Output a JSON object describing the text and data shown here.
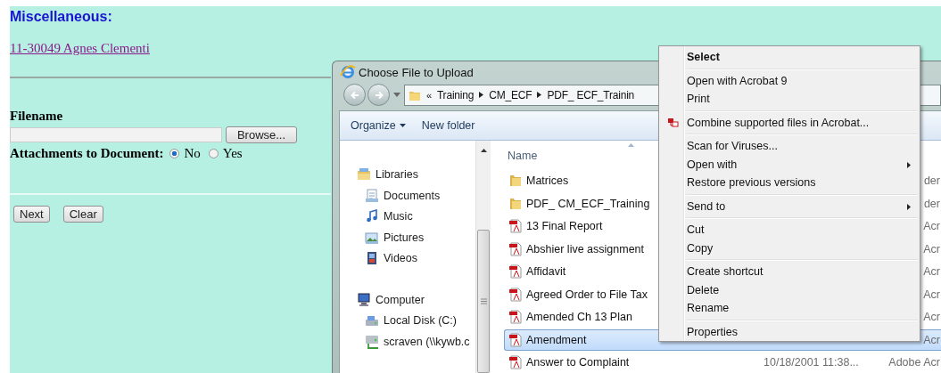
{
  "page": {
    "heading": "Miscellaneous:",
    "case_link": "11-30049 Agnes Clementi",
    "filename_label": "Filename",
    "browse_button": "Browse...",
    "attachments_label": "Attachments to Document:",
    "attachment_options": [
      {
        "label": "No",
        "selected": true
      },
      {
        "label": "Yes",
        "selected": false
      }
    ],
    "buttons": [
      "Next",
      "Clear"
    ]
  },
  "dialog": {
    "title": "Choose File to Upload",
    "address": {
      "overflow": "«",
      "segments": [
        "Training",
        "CM_ECF",
        "PDF_ ECF_Trainin"
      ]
    },
    "toolbar": [
      {
        "label": "Organize",
        "dropdown": true
      },
      {
        "label": "New folder",
        "dropdown": false
      }
    ],
    "nav": [
      {
        "label": "Libraries",
        "kind": "library",
        "children": [
          {
            "label": "Documents",
            "kind": "document"
          },
          {
            "label": "Music",
            "kind": "music"
          },
          {
            "label": "Pictures",
            "kind": "picture"
          },
          {
            "label": "Videos",
            "kind": "video"
          }
        ]
      },
      {
        "label": "Computer",
        "kind": "computer",
        "children": [
          {
            "label": "Local Disk (C:)",
            "kind": "disk"
          },
          {
            "label": "scraven (\\\\kywb.c",
            "kind": "network"
          }
        ]
      }
    ],
    "list": {
      "column": "Name",
      "rows": [
        {
          "name": "Matrices",
          "kind": "folder",
          "type": "der",
          "selected": false
        },
        {
          "name": "PDF_ CM_ECF_Training",
          "kind": "folder",
          "type": "der",
          "selected": false
        },
        {
          "name": "13 Final Report",
          "kind": "pdf",
          "type": "Acr",
          "selected": false
        },
        {
          "name": "Abshier live assignment",
          "kind": "pdf",
          "type": "Acr",
          "selected": false
        },
        {
          "name": "Affidavit",
          "kind": "pdf",
          "type": "Acr",
          "selected": false
        },
        {
          "name": "Agreed Order to File Tax",
          "kind": "pdf",
          "type": "Acr",
          "selected": false
        },
        {
          "name": "Amended Ch 13 Plan",
          "kind": "pdf",
          "type": "Acr",
          "selected": false
        },
        {
          "name": "Amendment",
          "kind": "pdf",
          "type": "Acr",
          "selected": true
        },
        {
          "name": "Answer to Complaint",
          "kind": "pdf",
          "date": "10/18/2001 11:38...",
          "type": "Adobe Acr",
          "selected": false
        }
      ]
    }
  },
  "context_menu": [
    [
      {
        "label": "Select",
        "kind": "plain",
        "default": true,
        "submenu": false
      }
    ],
    [
      {
        "label": "Open with Acrobat 9",
        "kind": "plain",
        "default": false,
        "submenu": false
      },
      {
        "label": "Print",
        "kind": "plain",
        "default": false,
        "submenu": false
      }
    ],
    [
      {
        "label": "Combine supported files in Acrobat...",
        "kind": "acrobat",
        "default": false,
        "submenu": false
      }
    ],
    [
      {
        "label": "Scan for Viruses...",
        "kind": "plain",
        "default": false,
        "submenu": false
      },
      {
        "label": "Open with",
        "kind": "plain",
        "default": false,
        "submenu": true
      },
      {
        "label": "Restore previous versions",
        "kind": "plain",
        "default": false,
        "submenu": false
      }
    ],
    [
      {
        "label": "Send to",
        "kind": "plain",
        "default": false,
        "submenu": true
      }
    ],
    [
      {
        "label": "Cut",
        "kind": "plain",
        "default": false,
        "submenu": false
      },
      {
        "label": "Copy",
        "kind": "plain",
        "default": false,
        "submenu": false
      }
    ],
    [
      {
        "label": "Create shortcut",
        "kind": "plain",
        "default": false,
        "submenu": false
      },
      {
        "label": "Delete",
        "kind": "plain",
        "default": false,
        "submenu": false
      },
      {
        "label": "Rename",
        "kind": "plain",
        "default": false,
        "submenu": false
      }
    ],
    [
      {
        "label": "Properties",
        "kind": "plain",
        "default": false,
        "submenu": false
      }
    ]
  ]
}
